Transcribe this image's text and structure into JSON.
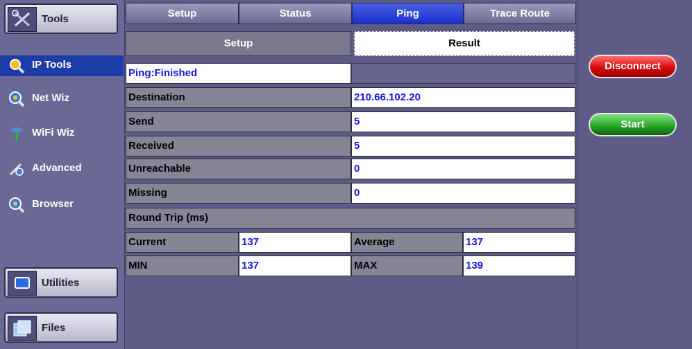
{
  "sidebar": {
    "tools_label": "Tools",
    "nav": [
      {
        "label": "IP Tools",
        "icon": "magnifier-icon",
        "active": true
      },
      {
        "label": "Net Wiz",
        "icon": "globe-magnifier-icon"
      },
      {
        "label": "WiFi Wiz",
        "icon": "wifi-antenna-icon"
      },
      {
        "label": "Advanced",
        "icon": "advanced-tool-icon"
      },
      {
        "label": "Browser",
        "icon": "globe-magnifier-icon"
      }
    ],
    "utilities_label": "Utilities",
    "files_label": "Files"
  },
  "tabs": [
    "Setup",
    "Status",
    "Ping",
    "Trace Route"
  ],
  "active_tab": "Ping",
  "subtabs": [
    "Setup",
    "Result"
  ],
  "active_subtab": "Result",
  "result": {
    "status": "Ping:Finished",
    "rows": [
      {
        "label": "Destination",
        "value": "210.66.102.20"
      },
      {
        "label": "Send",
        "value": "5"
      },
      {
        "label": "Received",
        "value": "5"
      },
      {
        "label": "Unreachable",
        "value": "0"
      },
      {
        "label": "Missing",
        "value": "0"
      }
    ],
    "round_trip_label": "Round Trip (ms)",
    "rtt": {
      "current_label": "Current",
      "current": "137",
      "average_label": "Average",
      "average": "137",
      "min_label": "MIN",
      "min": "137",
      "max_label": "MAX",
      "max": "139"
    }
  },
  "actions": {
    "disconnect_label": "Disconnect",
    "start_label": "Start"
  },
  "colors": {
    "background": "#5e5c86",
    "active_tab": "#1a2ed0",
    "value_text": "#1515e0",
    "disconnect": "#d80c0c",
    "start": "#2aa82a"
  }
}
